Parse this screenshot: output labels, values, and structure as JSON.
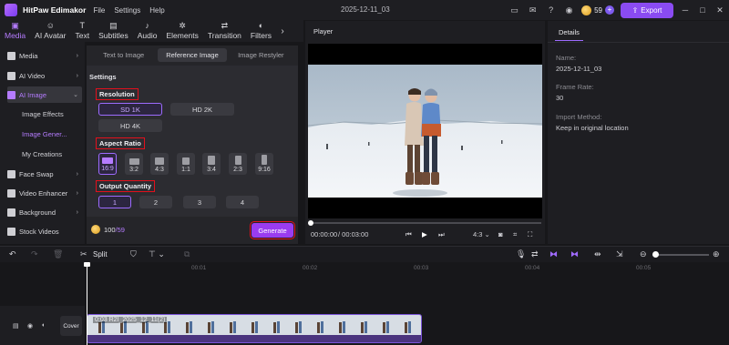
{
  "app": {
    "name": "HitPaw Edimakor",
    "menu": [
      "File",
      "Settings",
      "Help"
    ],
    "doc_title": "2025-12-11_03",
    "credits": "59",
    "export_label": "Export",
    "accent": "#8a4bf2"
  },
  "tools": [
    {
      "label": "Media",
      "icon": "media-icon",
      "glyph": "▣"
    },
    {
      "label": "AI Avatar",
      "icon": "ai-avatar-icon",
      "glyph": "☺"
    },
    {
      "label": "Text",
      "icon": "text-icon",
      "glyph": "T"
    },
    {
      "label": "Subtitles",
      "icon": "subtitles-icon",
      "glyph": "▤"
    },
    {
      "label": "Audio",
      "icon": "audio-icon",
      "glyph": "♪"
    },
    {
      "label": "Elements",
      "icon": "elements-icon",
      "glyph": "✲"
    },
    {
      "label": "Transition",
      "icon": "transition-icon",
      "glyph": "⇄"
    },
    {
      "label": "Filters",
      "icon": "filters-icon",
      "glyph": "◐"
    }
  ],
  "sidebar": {
    "items": [
      {
        "label": "Media",
        "icon": "folder-icon"
      },
      {
        "label": "AI Video",
        "icon": "ai-video-icon"
      },
      {
        "label": "AI Image",
        "icon": "ai-image-icon"
      },
      {
        "label": "Face Swap",
        "icon": "face-swap-icon"
      },
      {
        "label": "Video Enhancer",
        "icon": "video-enhancer-icon"
      },
      {
        "label": "Background",
        "icon": "background-icon"
      },
      {
        "label": "Stock Videos",
        "icon": "stock-videos-icon"
      }
    ],
    "subitems": [
      "Image Effects",
      "Image Gener...",
      "My Creations"
    ]
  },
  "ai_image": {
    "tabs": [
      "Text to Image",
      "Reference Image",
      "Image Restyler"
    ],
    "settings_title": "Settings",
    "resolution_label": "Resolution",
    "resolutions": [
      "SD 1K",
      "HD 2K",
      "HD 4K"
    ],
    "aspect_label": "Aspect Ratio",
    "aspects": [
      "16:9",
      "3:2",
      "4:3",
      "1:1",
      "3:4",
      "2:3",
      "9:16"
    ],
    "quantity_label": "Output Quantity",
    "quantities": [
      "1",
      "2",
      "3",
      "4"
    ],
    "usage_current": "100",
    "usage_max": "/59",
    "generate_label": "Generate"
  },
  "player": {
    "label": "Player",
    "time_current": "00:00:00",
    "time_total": "/ 00:03:00",
    "ratio": "4:3"
  },
  "details": {
    "tab": "Details",
    "name_label": "Name:",
    "name_value": "2025-12-11_03",
    "framerate_label": "Frame Rate:",
    "framerate_value": "30",
    "import_label": "Import Method:",
    "import_value": "Keep in original location"
  },
  "timeline": {
    "split_label": "Split",
    "ticks": [
      "00:01",
      "00:02",
      "00:03",
      "00:04",
      "00:05"
    ],
    "cover_label": "Cover",
    "clip_label": "0:03 R2I_2025_12_11(2)"
  }
}
